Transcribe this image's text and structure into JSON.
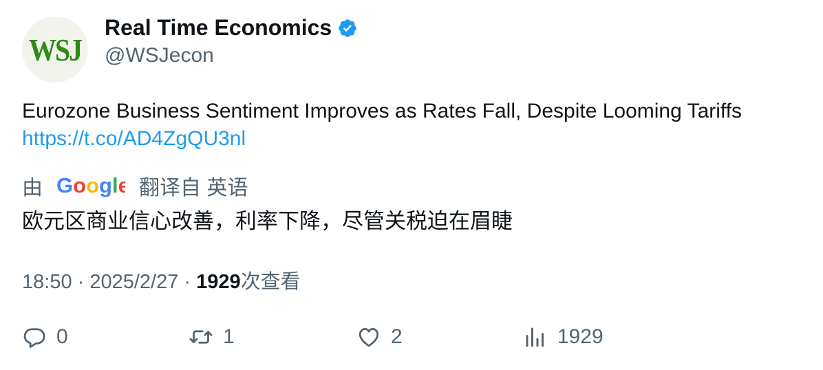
{
  "author": {
    "avatar_text": "WSJ",
    "display_name": "Real Time Economics",
    "handle": "@WSJecon",
    "verified_color": "#1d9bf0"
  },
  "tweet": {
    "text": "Eurozone Business Sentiment Improves as Rates Fall, Despite Looming Tariffs",
    "link": "https://t.co/AD4ZgQU3nl"
  },
  "translation": {
    "prefix": "由",
    "provider": "Google",
    "suffix": "翻译自 英语",
    "text": "欧元区商业信心改善，利率下降，尽管关税迫在眉睫"
  },
  "meta": {
    "time": "18:50",
    "date": "2025/2/27",
    "views": "1929",
    "views_label": "次查看"
  },
  "actions": {
    "replies": "0",
    "reposts": "1",
    "likes": "2",
    "views": "1929"
  },
  "colors": {
    "link": "#1d9bf0",
    "secondary": "#536471",
    "primary": "#0f1419"
  }
}
